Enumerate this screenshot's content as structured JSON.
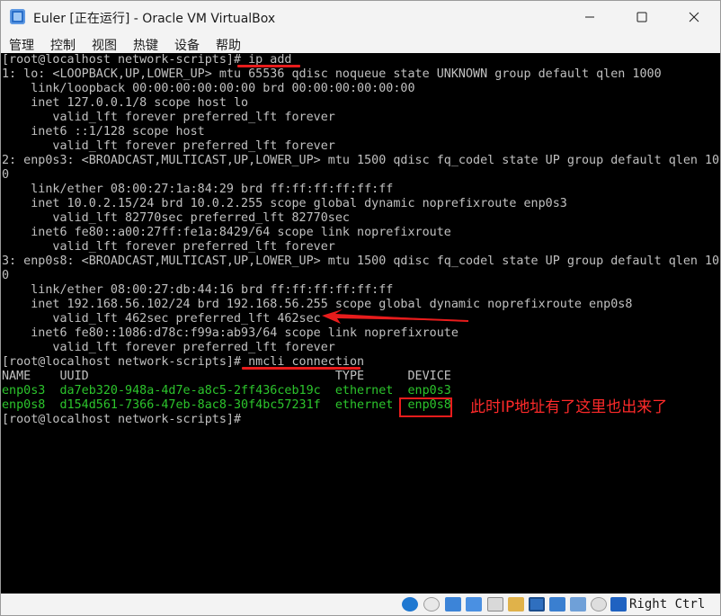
{
  "window": {
    "title": "Euler [正在运行] - Oracle VM VirtualBox",
    "minimize_glyph": "—",
    "maximize_glyph": "☐",
    "close_glyph": "✕"
  },
  "menu": [
    "管理",
    "控制",
    "视图",
    "热键",
    "设备",
    "帮助"
  ],
  "console": {
    "lines": [
      "[root@localhost network-scripts]# ip add",
      "1: lo: <LOOPBACK,UP,LOWER_UP> mtu 65536 qdisc noqueue state UNKNOWN group default qlen 1000",
      "    link/loopback 00:00:00:00:00:00 brd 00:00:00:00:00:00",
      "    inet 127.0.0.1/8 scope host lo",
      "       valid_lft forever preferred_lft forever",
      "    inet6 ::1/128 scope host",
      "       valid_lft forever preferred_lft forever",
      "2: enp0s3: <BROADCAST,MULTICAST,UP,LOWER_UP> mtu 1500 qdisc fq_codel state UP group default qlen 100",
      "0",
      "    link/ether 08:00:27:1a:84:29 brd ff:ff:ff:ff:ff:ff",
      "    inet 10.0.2.15/24 brd 10.0.2.255 scope global dynamic noprefixroute enp0s3",
      "       valid_lft 82770sec preferred_lft 82770sec",
      "    inet6 fe80::a00:27ff:fe1a:8429/64 scope link noprefixroute",
      "       valid_lft forever preferred_lft forever",
      "3: enp0s8: <BROADCAST,MULTICAST,UP,LOWER_UP> mtu 1500 qdisc fq_codel state UP group default qlen 100",
      "0",
      "    link/ether 08:00:27:db:44:16 brd ff:ff:ff:ff:ff:ff",
      "    inet 192.168.56.102/24 brd 192.168.56.255 scope global dynamic noprefixroute enp0s8",
      "       valid_lft 462sec preferred_lft 462sec",
      "    inet6 fe80::1086:d78c:f99a:ab93/64 scope link noprefixroute",
      "       valid_lft forever preferred_lft forever",
      "[root@localhost network-scripts]# nmcli connection",
      "NAME    UUID                                  TYPE      DEVICE",
      "enp0s3  da7eb320-948a-4d7e-a8c5-2ff436ceb19c  ethernet  enp0s3",
      "enp0s8  d154d561-7366-47eb-8ac8-30f4bc57231f  ethernet  enp0s8",
      "[root@localhost network-scripts]#"
    ],
    "green_line_indices": [
      23,
      24
    ],
    "text_color": "#c0c0c0",
    "green_color": "#2cc52c",
    "background": "#000000"
  },
  "annotation": {
    "text": "此时IP地址有了这里也出来了",
    "color": "#ff2a2a"
  },
  "statusbar": {
    "host_key": "Right Ctrl",
    "icons": [
      "hard-disk-icon",
      "optical-drive-icon",
      "audio-icon",
      "network-icon",
      "usb-icon",
      "shared-folder-icon",
      "display-icon",
      "video-capture-icon",
      "cpu-icon",
      "mouse-integration-icon",
      "keyboard-capture-icon"
    ]
  }
}
